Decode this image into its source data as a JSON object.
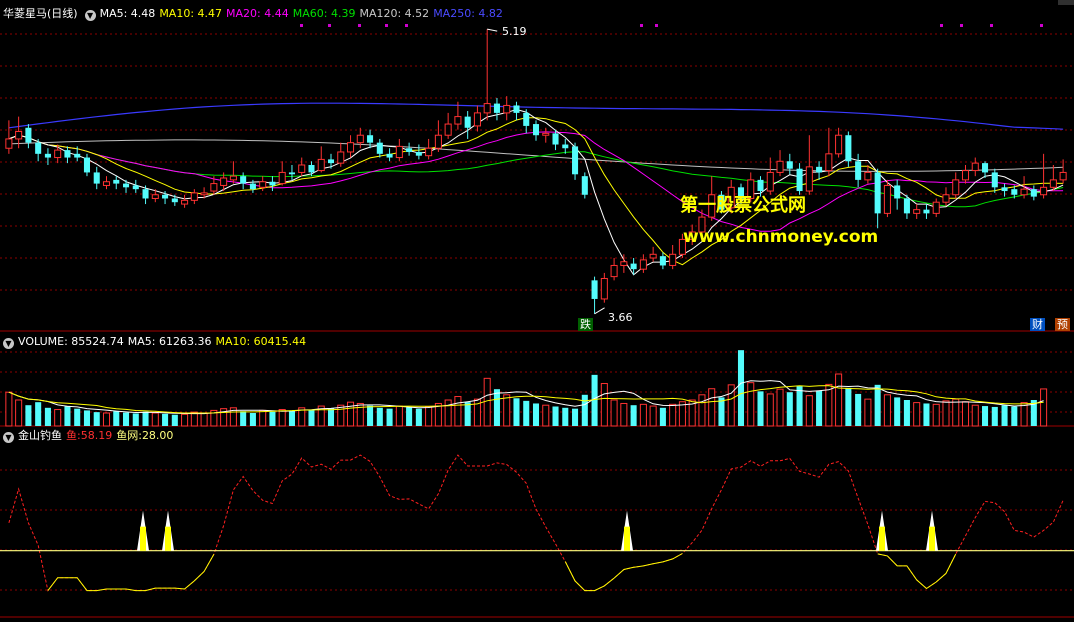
{
  "colors": {
    "up": "#ff3232",
    "down": "#54fcfc",
    "ma5": "#ffffff",
    "ma10": "#ffff00",
    "ma20": "#ff00ff",
    "ma60": "#00e000",
    "ma120": "#c0c0c0",
    "ma250": "#3a3aff",
    "vol_ma5": "#ffffff",
    "vol_ma10": "#ffff00",
    "fish": "#ff2020",
    "net": "#ffff80",
    "grid": "#8b0000"
  },
  "main_header": {
    "title": "华菱星马(日线)",
    "ma5": "MA5: 4.48",
    "ma10": "MA10: 4.47",
    "ma20": "MA20: 4.44",
    "ma60": "MA60: 4.39",
    "ma120": "MA120: 4.52",
    "ma250": "MA250: 4.82"
  },
  "annotations": {
    "high_label": "5.19",
    "low_label": "3.66",
    "fall_badge": "跌",
    "fin_badge": "财",
    "pre_badge": "预"
  },
  "watermark": {
    "line1": "第一股票公式网",
    "line2": "www.chnmoney.com"
  },
  "volume_header": {
    "title": "VOLUME: 85524.74",
    "ma5": "MA5: 61263.36",
    "ma10": "MA10: 60415.44"
  },
  "indicator_header": {
    "title": "金山钓鱼",
    "fish_label": "鱼:",
    "fish_value": "58.19",
    "net_label": "鱼网:",
    "net_value": "28.00"
  },
  "chart_data": [
    {
      "type": "candlestick",
      "name": "price",
      "ylim": [
        3.6,
        5.25
      ],
      "high_point": 5.19,
      "low_point": 3.66,
      "ma_values": {
        "MA5": 4.48,
        "MA10": 4.47,
        "MA20": 4.44,
        "MA60": 4.39,
        "MA120": 4.52,
        "MA250": 4.82
      },
      "candles": [
        [
          4.55,
          4.6,
          4.7,
          4.52
        ],
        [
          4.6,
          4.64,
          4.72,
          4.55
        ],
        [
          4.66,
          4.58,
          4.68,
          4.55
        ],
        [
          4.58,
          4.52,
          4.6,
          4.48
        ],
        [
          4.52,
          4.5,
          4.55,
          4.46
        ],
        [
          4.5,
          4.54,
          4.57,
          4.47
        ],
        [
          4.54,
          4.5,
          4.56,
          4.47
        ],
        [
          4.52,
          4.5,
          4.56,
          4.48
        ],
        [
          4.5,
          4.42,
          4.52,
          4.4
        ],
        [
          4.42,
          4.36,
          4.45,
          4.33
        ],
        [
          4.35,
          4.37,
          4.4,
          4.33
        ],
        [
          4.38,
          4.36,
          4.4,
          4.33
        ],
        [
          4.36,
          4.34,
          4.38,
          4.31
        ],
        [
          4.35,
          4.33,
          4.38,
          4.31
        ],
        [
          4.33,
          4.28,
          4.35,
          4.25
        ],
        [
          4.28,
          4.3,
          4.33,
          4.26
        ],
        [
          4.3,
          4.28,
          4.32,
          4.25
        ],
        [
          4.28,
          4.26,
          4.3,
          4.24
        ],
        [
          4.25,
          4.27,
          4.3,
          4.23
        ],
        [
          4.27,
          4.31,
          4.33,
          4.25
        ],
        [
          4.3,
          4.31,
          4.34,
          4.28
        ],
        [
          4.32,
          4.36,
          4.4,
          4.3
        ],
        [
          4.35,
          4.39,
          4.42,
          4.32
        ],
        [
          4.38,
          4.4,
          4.48,
          4.36
        ],
        [
          4.4,
          4.36,
          4.42,
          4.33
        ],
        [
          4.36,
          4.33,
          4.38,
          4.31
        ],
        [
          4.34,
          4.37,
          4.4,
          4.32
        ],
        [
          4.37,
          4.35,
          4.4,
          4.32
        ],
        [
          4.36,
          4.42,
          4.48,
          4.35
        ],
        [
          4.42,
          4.41,
          4.46,
          4.38
        ],
        [
          4.42,
          4.46,
          4.5,
          4.4
        ],
        [
          4.46,
          4.42,
          4.48,
          4.4
        ],
        [
          4.43,
          4.49,
          4.56,
          4.42
        ],
        [
          4.49,
          4.47,
          4.52,
          4.44
        ],
        [
          4.47,
          4.53,
          4.58,
          4.45
        ],
        [
          4.53,
          4.58,
          4.62,
          4.5
        ],
        [
          4.58,
          4.62,
          4.66,
          4.55
        ],
        [
          4.62,
          4.58,
          4.65,
          4.55
        ],
        [
          4.58,
          4.52,
          4.6,
          4.5
        ],
        [
          4.52,
          4.5,
          4.55,
          4.48
        ],
        [
          4.5,
          4.56,
          4.6,
          4.48
        ],
        [
          4.55,
          4.53,
          4.58,
          4.51
        ],
        [
          4.53,
          4.51,
          4.57,
          4.49
        ],
        [
          4.51,
          4.55,
          4.6,
          4.49
        ],
        [
          4.55,
          4.62,
          4.7,
          4.53
        ],
        [
          4.62,
          4.68,
          4.74,
          4.6
        ],
        [
          4.68,
          4.72,
          4.8,
          4.65
        ],
        [
          4.72,
          4.66,
          4.75,
          4.6
        ],
        [
          4.67,
          4.74,
          4.78,
          4.64
        ],
        [
          4.74,
          4.79,
          5.19,
          4.7
        ],
        [
          4.79,
          4.74,
          4.82,
          4.7
        ],
        [
          4.74,
          4.78,
          4.83,
          4.7
        ],
        [
          4.78,
          4.74,
          4.8,
          4.7
        ],
        [
          4.74,
          4.67,
          4.76,
          4.63
        ],
        [
          4.68,
          4.62,
          4.7,
          4.59
        ],
        [
          4.62,
          4.63,
          4.66,
          4.58
        ],
        [
          4.63,
          4.57,
          4.65,
          4.54
        ],
        [
          4.57,
          4.55,
          4.6,
          4.52
        ],
        [
          4.56,
          4.41,
          4.58,
          4.38
        ],
        [
          4.4,
          4.3,
          4.42,
          4.28
        ],
        [
          3.84,
          3.74,
          3.86,
          3.66
        ],
        [
          3.74,
          3.85,
          3.88,
          3.72
        ],
        [
          3.86,
          3.92,
          3.96,
          3.84
        ],
        [
          3.92,
          3.94,
          3.98,
          3.88
        ],
        [
          3.93,
          3.9,
          3.96,
          3.87
        ],
        [
          3.9,
          3.95,
          3.98,
          3.88
        ],
        [
          3.96,
          3.98,
          4.02,
          3.94
        ],
        [
          3.97,
          3.92,
          3.99,
          3.9
        ],
        [
          3.92,
          3.98,
          4.03,
          3.9
        ],
        [
          3.98,
          4.06,
          4.09,
          3.96
        ],
        [
          4.06,
          4.1,
          4.14,
          4.03
        ],
        [
          4.1,
          4.18,
          4.22,
          4.08
        ],
        [
          4.18,
          4.3,
          4.4,
          4.16
        ],
        [
          4.3,
          4.22,
          4.32,
          4.2
        ],
        [
          4.23,
          4.34,
          4.38,
          4.2
        ],
        [
          4.34,
          4.28,
          4.36,
          4.25
        ],
        [
          4.28,
          4.38,
          4.42,
          4.26
        ],
        [
          4.38,
          4.32,
          4.4,
          4.29
        ],
        [
          4.32,
          4.42,
          4.5,
          4.3
        ],
        [
          4.42,
          4.48,
          4.54,
          4.4
        ],
        [
          4.48,
          4.44,
          4.52,
          4.41
        ],
        [
          4.44,
          4.32,
          4.47,
          4.3
        ],
        [
          4.32,
          4.45,
          4.62,
          4.3
        ],
        [
          4.45,
          4.42,
          4.48,
          4.38
        ],
        [
          4.43,
          4.52,
          4.66,
          4.4
        ],
        [
          4.52,
          4.62,
          4.66,
          4.5
        ],
        [
          4.62,
          4.48,
          4.64,
          4.45
        ],
        [
          4.48,
          4.38,
          4.52,
          4.34
        ],
        [
          4.38,
          4.42,
          4.46,
          4.36
        ],
        [
          4.42,
          4.2,
          4.44,
          4.12
        ],
        [
          4.2,
          4.35,
          4.38,
          4.18
        ],
        [
          4.35,
          4.28,
          4.38,
          4.22
        ],
        [
          4.28,
          4.2,
          4.3,
          4.17
        ],
        [
          4.2,
          4.22,
          4.25,
          4.17
        ],
        [
          4.22,
          4.2,
          4.25,
          4.17
        ],
        [
          4.2,
          4.26,
          4.28,
          4.18
        ],
        [
          4.26,
          4.3,
          4.34,
          4.24
        ],
        [
          4.3,
          4.38,
          4.42,
          4.28
        ],
        [
          4.38,
          4.43,
          4.46,
          4.36
        ],
        [
          4.43,
          4.47,
          4.5,
          4.4
        ],
        [
          4.47,
          4.42,
          4.48,
          4.39
        ],
        [
          4.42,
          4.34,
          4.44,
          4.31
        ],
        [
          4.34,
          4.32,
          4.36,
          4.29
        ],
        [
          4.33,
          4.3,
          4.35,
          4.28
        ],
        [
          4.3,
          4.33,
          4.4,
          4.28
        ],
        [
          4.33,
          4.29,
          4.35,
          4.27
        ],
        [
          4.3,
          4.34,
          4.52,
          4.28
        ],
        [
          4.34,
          4.38,
          4.46,
          4.32
        ],
        [
          4.38,
          4.42,
          4.49,
          4.36
        ]
      ]
    },
    {
      "type": "bar",
      "name": "volume",
      "ylim": [
        0,
        180000
      ],
      "ma5": 61263.36,
      "ma10": 60415.44,
      "latest": 85524.74,
      "values": [
        78000,
        60000,
        48000,
        55000,
        42000,
        38000,
        45000,
        40000,
        36000,
        32000,
        30000,
        34000,
        31000,
        29000,
        33000,
        30000,
        28000,
        26000,
        27000,
        32000,
        30000,
        36000,
        40000,
        42000,
        34000,
        30000,
        36000,
        33000,
        38000,
        36000,
        42000,
        38000,
        46000,
        41000,
        48000,
        55000,
        52000,
        47000,
        42000,
        40000,
        46000,
        43000,
        40000,
        45000,
        52000,
        60000,
        68000,
        55000,
        62000,
        110000,
        85000,
        72000,
        64000,
        58000,
        52000,
        48000,
        45000,
        42000,
        40000,
        72000,
        118000,
        98000,
        60000,
        52000,
        48000,
        50000,
        46000,
        42000,
        50000,
        56000,
        60000,
        72000,
        86000,
        66000,
        95000,
        175000,
        100000,
        80000,
        74000,
        85000,
        78000,
        92000,
        70000,
        82000,
        96000,
        120000,
        88000,
        74000,
        62000,
        95000,
        72000,
        66000,
        60000,
        54000,
        52000,
        50000,
        58000,
        62000,
        56000,
        48000,
        46000,
        44000,
        48000,
        45000,
        54000,
        60000,
        85524.74
      ]
    },
    {
      "type": "line",
      "name": "金山钓鱼",
      "series": [
        {
          "name": "鱼",
          "latest": 58.19
        },
        {
          "name": "鱼网",
          "latest": 28.0
        }
      ],
      "ylim": [
        -15,
        100
      ],
      "signal_count": 5
    }
  ]
}
